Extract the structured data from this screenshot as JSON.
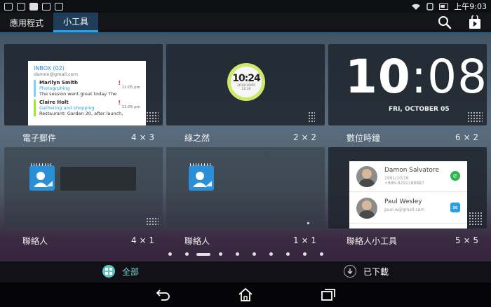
{
  "status_bar": {
    "time": "上午9:03"
  },
  "tabs": [
    {
      "label": "應用程式",
      "active": false
    },
    {
      "label": "小工具",
      "active": true
    }
  ],
  "header_actions": {
    "search_icon": "search-icon",
    "store_icon": "play-store-icon"
  },
  "widgets": [
    {
      "name": "電子郵件",
      "size": "4 × 3",
      "preview": {
        "inbox": "INBOX (02)",
        "account": "damon@gmail.com",
        "messages": [
          {
            "from": "Marilyn Smith",
            "category": "Photogrphing",
            "body": "The session went great today The",
            "time": "11:05 pm"
          },
          {
            "from": "Claire Holt",
            "category": "Gathering and shopping",
            "body": "Restaurant: Garden 20, after launch,",
            "time": "11:05 pm"
          }
        ]
      }
    },
    {
      "name": "綠之然",
      "size": "2 × 2",
      "preview": {
        "time": "10:24",
        "date": "2012/10/05",
        "temp": "12:30"
      }
    },
    {
      "name": "數位時鐘",
      "size": "6 × 2",
      "preview": {
        "hours": "10",
        "minutes": "08",
        "date": "FRI, OCTOBER 05"
      }
    },
    {
      "name": "聯絡人",
      "size": "4 × 1"
    },
    {
      "name": "聯絡人",
      "size": "1 × 1"
    },
    {
      "name": "聯絡人小工具",
      "size": "5 × 5",
      "preview": {
        "contacts": [
          {
            "name": "Damon Salvatore",
            "line1": "1981/10/16",
            "line2": "+886-9291188887",
            "action": "phone"
          },
          {
            "name": "Paul Wesley",
            "line1": "paul.w@gmail.com",
            "line2": "",
            "action": "email"
          }
        ]
      }
    }
  ],
  "page_indicator": {
    "total": 10,
    "active": 2
  },
  "filter_bar": {
    "all_label": "全部",
    "downloaded_label": "已下載"
  },
  "nav": {
    "back_icon": "back-icon",
    "home_icon": "home-icon",
    "recents_icon": "recents-icon"
  },
  "colors": {
    "accent": "#2aa0e6",
    "clock_green": "#cfe86b",
    "contact_blue": "#2b8fd8",
    "filter_teal": "#5fc5c2"
  }
}
